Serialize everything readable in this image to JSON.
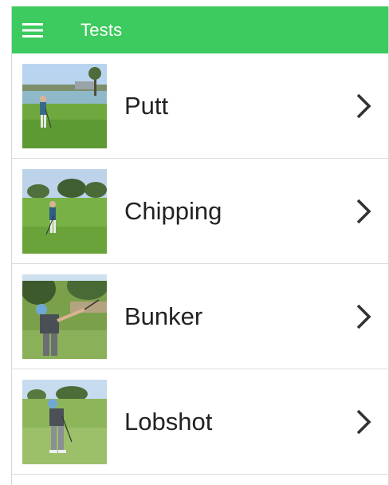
{
  "appbar": {
    "title": "Tests",
    "menu_icon": "hamburger-menu-icon",
    "color": "#3dca5e"
  },
  "tests": [
    {
      "label": "Putt",
      "image": "golfer-putting-photo",
      "chevron_icon": "chevron-right-icon"
    },
    {
      "label": "Chipping",
      "image": "golfer-chipping-photo",
      "chevron_icon": "chevron-right-icon"
    },
    {
      "label": "Bunker",
      "image": "golfer-bunker-swing-photo",
      "chevron_icon": "chevron-right-icon"
    },
    {
      "label": "Lobshot",
      "image": "golfer-lobshot-photo",
      "chevron_icon": "chevron-right-icon"
    }
  ]
}
